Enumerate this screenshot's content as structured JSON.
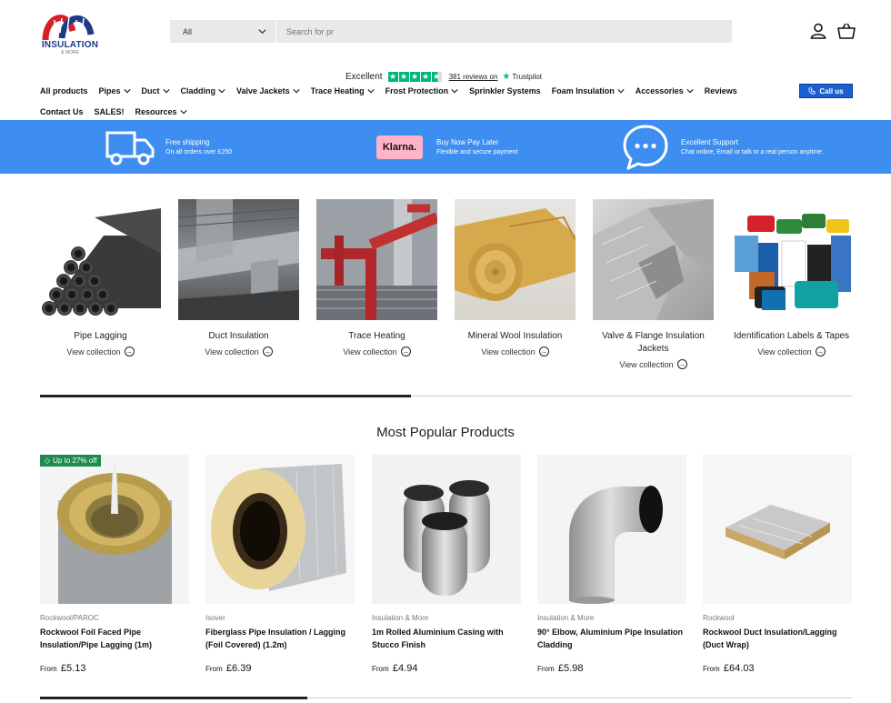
{
  "header": {
    "logo_text": "INSULATION",
    "logo_sub": "& MORE",
    "search_category": "All",
    "search_placeholder": "Search for pr",
    "icons": [
      "user-icon",
      "cart-icon"
    ]
  },
  "trustpilot": {
    "rating_word": "Excellent",
    "reviews": "381 reviews on",
    "brand": "Trustpilot",
    "color": "#00b67a"
  },
  "nav": {
    "row1": [
      {
        "label": "All products",
        "dropdown": false
      },
      {
        "label": "Pipes",
        "dropdown": true
      },
      {
        "label": "Duct",
        "dropdown": true
      },
      {
        "label": "Cladding",
        "dropdown": true
      },
      {
        "label": "Valve Jackets",
        "dropdown": true
      },
      {
        "label": "Trace Heating",
        "dropdown": true
      },
      {
        "label": "Frost Protection",
        "dropdown": true
      },
      {
        "label": "Sprinkler Systems",
        "dropdown": false
      },
      {
        "label": "Foam Insulation",
        "dropdown": true
      },
      {
        "label": "Accessories",
        "dropdown": true
      },
      {
        "label": "Reviews",
        "dropdown": false
      }
    ],
    "row2": [
      {
        "label": "Contact Us",
        "dropdown": false
      },
      {
        "label": "SALES!",
        "dropdown": false
      },
      {
        "label": "Resources",
        "dropdown": true
      }
    ],
    "call_us": "Call us"
  },
  "banner": {
    "color": "#3d8ef0",
    "items": [
      {
        "icon": "truck-icon",
        "title": "Free shipping",
        "sub": "On all orders over £250"
      },
      {
        "icon": "klarna-logo",
        "logo": "Klarna.",
        "title": "Buy Now Pay Later",
        "sub": "Flexible and secure payment"
      },
      {
        "icon": "chat-icon",
        "title": "Excellent Support",
        "sub": "Chat online, Email or talk to a real person anytime."
      }
    ]
  },
  "categories": [
    {
      "name": "Pipe Lagging",
      "link": "View collection"
    },
    {
      "name": "Duct Insulation",
      "link": "View collection"
    },
    {
      "name": "Trace Heating",
      "link": "View collection"
    },
    {
      "name": "Mineral Wool Insulation",
      "link": "View collection"
    },
    {
      "name": "Valve & Flange Insulation Jackets",
      "link": "View collection"
    },
    {
      "name": "Identification Labels & Tapes",
      "link": "View collection"
    }
  ],
  "popular": {
    "title": "Most Popular Products",
    "products": [
      {
        "badge": "Up to 27% off",
        "vendor": "Rockwool/PAROC",
        "title": "Rockwool Foil Faced Pipe Insulation/Pipe Lagging (1m)",
        "from": "From",
        "price": "£5.13"
      },
      {
        "badge": "",
        "vendor": "Isover",
        "title": "Fiberglass Pipe Insulation / Lagging (Foil Covered) (1.2m)",
        "from": "From",
        "price": "£6.39"
      },
      {
        "badge": "",
        "vendor": "Insulation & More",
        "title": "1m Rolled Aluminium Casing with Stucco Finish",
        "from": "From",
        "price": "£4.94"
      },
      {
        "badge": "",
        "vendor": "Insulation & More",
        "title": "90° Elbow, Aluminium Pipe Insulation Cladding",
        "from": "From",
        "price": "£5.98"
      },
      {
        "badge": "",
        "vendor": "Rockwool",
        "title": "Rockwool Duct Insulation/Lagging (Duct Wrap)",
        "from": "From",
        "price": "£64.03"
      }
    ]
  }
}
